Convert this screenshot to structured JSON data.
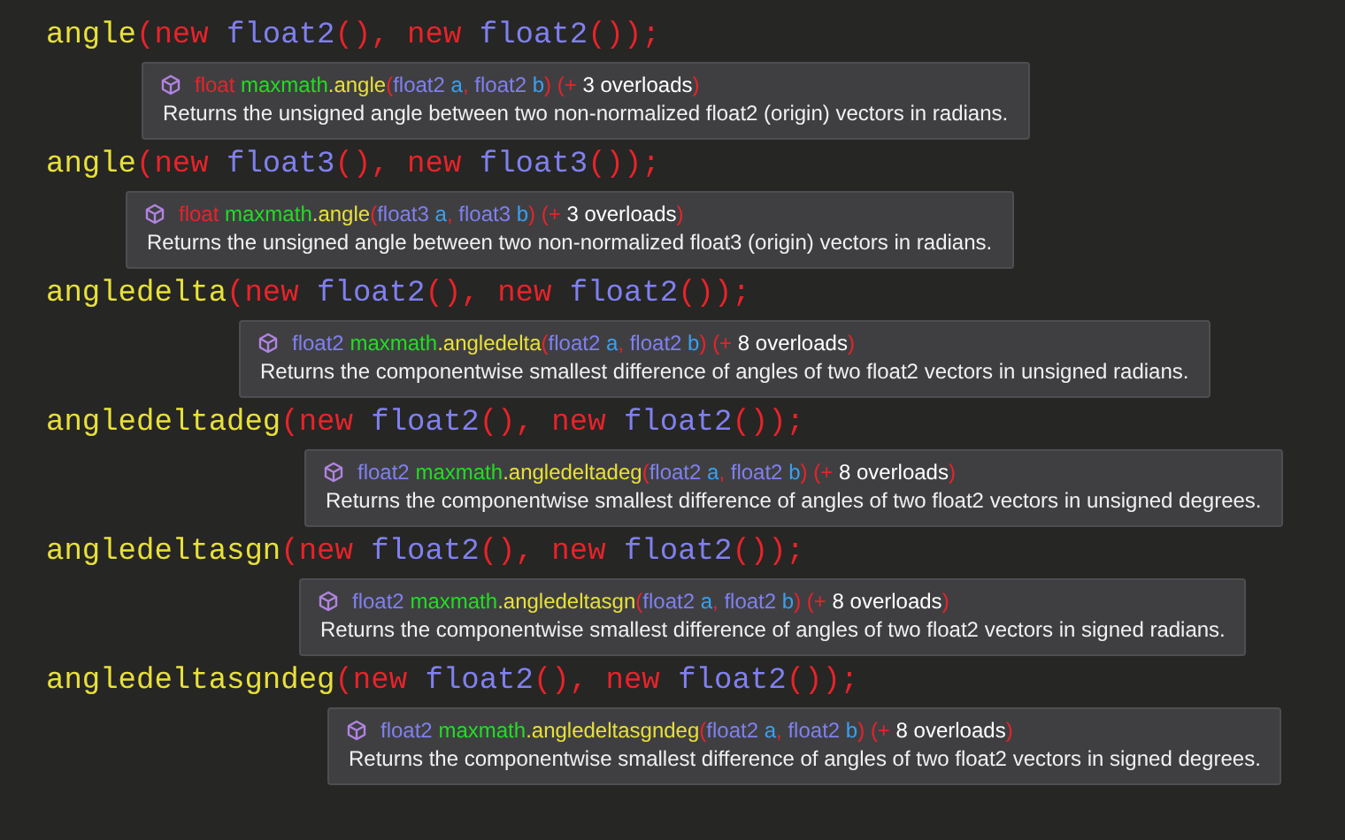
{
  "entries": [
    {
      "code": [
        {
          "kind": "method",
          "text": "angle"
        },
        {
          "kind": "keyword",
          "text": "(new "
        },
        {
          "kind": "type",
          "text": "float2"
        },
        {
          "kind": "keyword",
          "text": "(), new "
        },
        {
          "kind": "type",
          "text": "float2"
        },
        {
          "kind": "keyword",
          "text": "());"
        }
      ],
      "signature": [
        {
          "kind": "keyword",
          "text": "float "
        },
        {
          "kind": "class",
          "text": "maxmath"
        },
        {
          "kind": "method",
          "text": ".angle"
        },
        {
          "kind": "keyword",
          "text": "("
        },
        {
          "kind": "type",
          "text": "float2 "
        },
        {
          "kind": "param",
          "text": "a"
        },
        {
          "kind": "keyword",
          "text": ", "
        },
        {
          "kind": "type",
          "text": "float2 "
        },
        {
          "kind": "param",
          "text": "b"
        },
        {
          "kind": "keyword",
          "text": ") (+ "
        },
        {
          "kind": "text",
          "text": "3 overloads"
        },
        {
          "kind": "keyword",
          "text": ")"
        }
      ],
      "description": "Returns the unsigned angle between two non-normalized float2 (origin) vectors in radians."
    },
    {
      "code": [
        {
          "kind": "method",
          "text": "angle"
        },
        {
          "kind": "keyword",
          "text": "(new "
        },
        {
          "kind": "type",
          "text": "float3"
        },
        {
          "kind": "keyword",
          "text": "(), new "
        },
        {
          "kind": "type",
          "text": "float3"
        },
        {
          "kind": "keyword",
          "text": "());"
        }
      ],
      "signature": [
        {
          "kind": "keyword",
          "text": "float "
        },
        {
          "kind": "class",
          "text": "maxmath"
        },
        {
          "kind": "method",
          "text": ".angle"
        },
        {
          "kind": "keyword",
          "text": "("
        },
        {
          "kind": "type",
          "text": "float3 "
        },
        {
          "kind": "param",
          "text": "a"
        },
        {
          "kind": "keyword",
          "text": ", "
        },
        {
          "kind": "type",
          "text": "float3 "
        },
        {
          "kind": "param",
          "text": "b"
        },
        {
          "kind": "keyword",
          "text": ") (+ "
        },
        {
          "kind": "text",
          "text": "3 overloads"
        },
        {
          "kind": "keyword",
          "text": ")"
        }
      ],
      "description": "Returns the unsigned angle between two non-normalized float3 (origin) vectors in radians."
    },
    {
      "code": [
        {
          "kind": "method",
          "text": "angledelta"
        },
        {
          "kind": "keyword",
          "text": "(new "
        },
        {
          "kind": "type",
          "text": "float2"
        },
        {
          "kind": "keyword",
          "text": "(), new "
        },
        {
          "kind": "type",
          "text": "float2"
        },
        {
          "kind": "keyword",
          "text": "());"
        }
      ],
      "signature": [
        {
          "kind": "type",
          "text": "float2 "
        },
        {
          "kind": "class",
          "text": "maxmath"
        },
        {
          "kind": "method",
          "text": ".angledelta"
        },
        {
          "kind": "keyword",
          "text": "("
        },
        {
          "kind": "type",
          "text": "float2 "
        },
        {
          "kind": "param",
          "text": "a"
        },
        {
          "kind": "keyword",
          "text": ", "
        },
        {
          "kind": "type",
          "text": "float2 "
        },
        {
          "kind": "param",
          "text": "b"
        },
        {
          "kind": "keyword",
          "text": ") (+ "
        },
        {
          "kind": "text",
          "text": "8 overloads"
        },
        {
          "kind": "keyword",
          "text": ")"
        }
      ],
      "description": "Returns the componentwise smallest difference of angles of two float2 vectors in unsigned radians."
    },
    {
      "code": [
        {
          "kind": "method",
          "text": "angledeltadeg"
        },
        {
          "kind": "keyword",
          "text": "(new "
        },
        {
          "kind": "type",
          "text": "float2"
        },
        {
          "kind": "keyword",
          "text": "(), new "
        },
        {
          "kind": "type",
          "text": "float2"
        },
        {
          "kind": "keyword",
          "text": "());"
        }
      ],
      "signature": [
        {
          "kind": "type",
          "text": "float2 "
        },
        {
          "kind": "class",
          "text": "maxmath"
        },
        {
          "kind": "method",
          "text": ".angledeltadeg"
        },
        {
          "kind": "keyword",
          "text": "("
        },
        {
          "kind": "type",
          "text": "float2 "
        },
        {
          "kind": "param",
          "text": "a"
        },
        {
          "kind": "keyword",
          "text": ", "
        },
        {
          "kind": "type",
          "text": "float2 "
        },
        {
          "kind": "param",
          "text": "b"
        },
        {
          "kind": "keyword",
          "text": ") (+ "
        },
        {
          "kind": "text",
          "text": "8 overloads"
        },
        {
          "kind": "keyword",
          "text": ")"
        }
      ],
      "description": "Returns the componentwise smallest difference of angles of two float2 vectors in unsigned degrees."
    },
    {
      "code": [
        {
          "kind": "method",
          "text": "angledeltasgn"
        },
        {
          "kind": "keyword",
          "text": "(new "
        },
        {
          "kind": "type",
          "text": "float2"
        },
        {
          "kind": "keyword",
          "text": "(), new "
        },
        {
          "kind": "type",
          "text": "float2"
        },
        {
          "kind": "keyword",
          "text": "());"
        }
      ],
      "signature": [
        {
          "kind": "type",
          "text": "float2 "
        },
        {
          "kind": "class",
          "text": "maxmath"
        },
        {
          "kind": "method",
          "text": ".angledeltasgn"
        },
        {
          "kind": "keyword",
          "text": "("
        },
        {
          "kind": "type",
          "text": "float2 "
        },
        {
          "kind": "param",
          "text": "a"
        },
        {
          "kind": "keyword",
          "text": ", "
        },
        {
          "kind": "type",
          "text": "float2 "
        },
        {
          "kind": "param",
          "text": "b"
        },
        {
          "kind": "keyword",
          "text": ") (+ "
        },
        {
          "kind": "text",
          "text": "8 overloads"
        },
        {
          "kind": "keyword",
          "text": ")"
        }
      ],
      "description": "Returns the componentwise smallest difference of angles of two float2 vectors in signed radians."
    },
    {
      "code": [
        {
          "kind": "method",
          "text": "angledeltasgndeg"
        },
        {
          "kind": "keyword",
          "text": "(new "
        },
        {
          "kind": "type",
          "text": "float2"
        },
        {
          "kind": "keyword",
          "text": "(), new "
        },
        {
          "kind": "type",
          "text": "float2"
        },
        {
          "kind": "keyword",
          "text": "());"
        }
      ],
      "signature": [
        {
          "kind": "type",
          "text": "float2 "
        },
        {
          "kind": "class",
          "text": "maxmath"
        },
        {
          "kind": "method",
          "text": ".angledeltasgndeg"
        },
        {
          "kind": "keyword",
          "text": "("
        },
        {
          "kind": "type",
          "text": "float2 "
        },
        {
          "kind": "param",
          "text": "a"
        },
        {
          "kind": "keyword",
          "text": ", "
        },
        {
          "kind": "type",
          "text": "float2 "
        },
        {
          "kind": "param",
          "text": "b"
        },
        {
          "kind": "keyword",
          "text": ") (+ "
        },
        {
          "kind": "text",
          "text": "8 overloads"
        },
        {
          "kind": "keyword",
          "text": ")"
        }
      ],
      "description": "Returns the componentwise smallest difference of angles of two float2 vectors in signed degrees."
    }
  ]
}
